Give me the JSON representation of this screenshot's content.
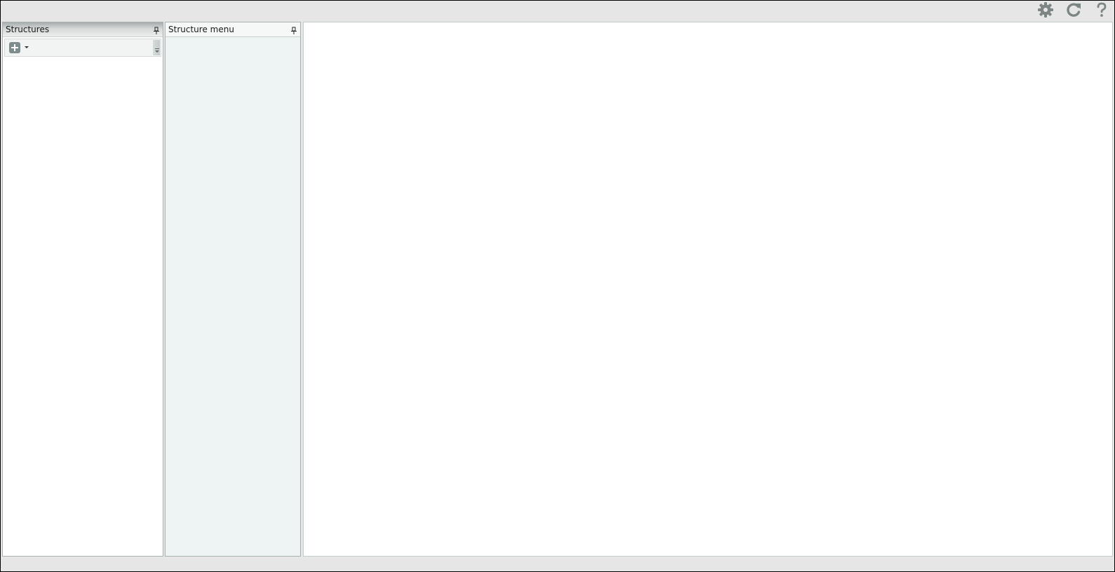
{
  "toolbar": {
    "icons": [
      "gear-icon",
      "refresh-icon",
      "help-icon"
    ],
    "icon_color": "#7d8585"
  },
  "structures_panel": {
    "title": "Structures",
    "toolbar": {
      "add_icon": "plus-square-icon",
      "dropdown_icon": "caret-down-icon"
    }
  },
  "structure_menu_panel": {
    "title": "Structure menu"
  },
  "colors": {
    "background": "#e6e6e6",
    "panel_border": "#a8b0b0",
    "menu_panel_bg": "#eef4f4",
    "content_bg": "#ffffff"
  }
}
